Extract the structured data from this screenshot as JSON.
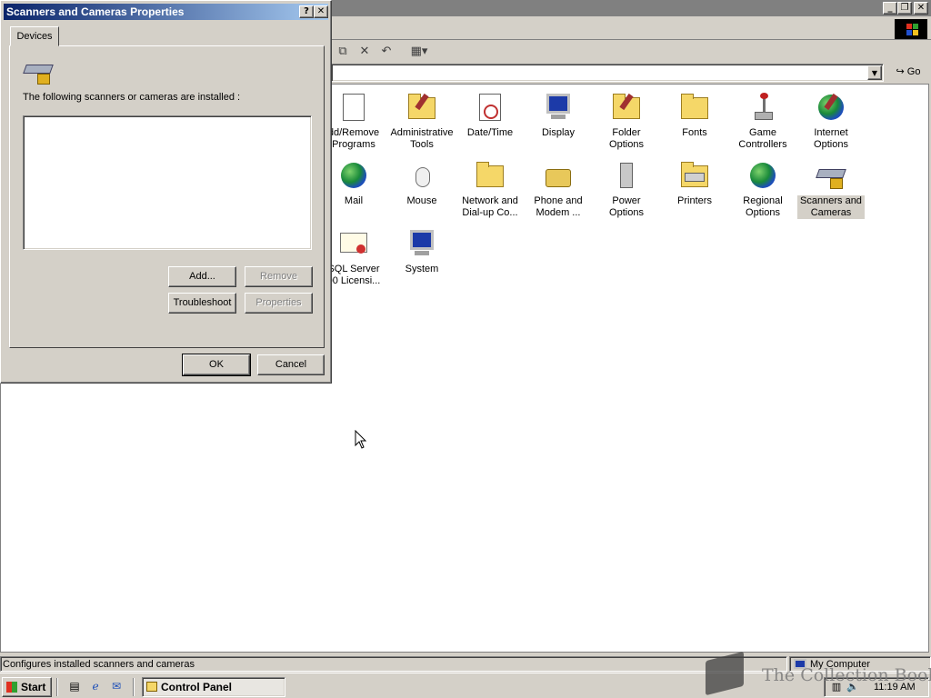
{
  "dialog": {
    "title": "Scanners and Cameras Properties",
    "help_glyph": "?",
    "close_glyph": "✕",
    "tab_devices": "Devices",
    "message": "The following scanners or cameras are installed :",
    "buttons": {
      "add": "Add...",
      "remove": "Remove",
      "troubleshoot": "Troubleshoot",
      "properties": "Properties",
      "ok": "OK",
      "cancel": "Cancel"
    }
  },
  "control_panel": {
    "items": [
      {
        "label": "dd/Remove Programs",
        "icon": "add-remove-programs-icon"
      },
      {
        "label": "Administrative Tools",
        "icon": "administrative-tools-icon"
      },
      {
        "label": "Date/Time",
        "icon": "date-time-icon"
      },
      {
        "label": "Display",
        "icon": "display-icon"
      },
      {
        "label": "Folder Options",
        "icon": "folder-options-icon"
      },
      {
        "label": "Fonts",
        "icon": "fonts-icon"
      },
      {
        "label": "Game Controllers",
        "icon": "game-controllers-icon"
      },
      {
        "label": "Internet Options",
        "icon": "internet-options-icon"
      },
      {
        "label": "Mail",
        "icon": "mail-icon"
      },
      {
        "label": "Mouse",
        "icon": "mouse-icon"
      },
      {
        "label": "Network and Dial-up Co...",
        "icon": "network-icon"
      },
      {
        "label": "Phone and Modem ...",
        "icon": "phone-modem-icon"
      },
      {
        "label": "Power Options",
        "icon": "power-options-icon"
      },
      {
        "label": "Printers",
        "icon": "printers-icon"
      },
      {
        "label": "Regional Options",
        "icon": "regional-options-icon"
      },
      {
        "label": "Scanners and Cameras",
        "icon": "scanners-cameras-icon"
      },
      {
        "label": "SQL Server 00 Licensi...",
        "icon": "sql-licensing-icon"
      },
      {
        "label": "System",
        "icon": "system-icon"
      }
    ],
    "go_label": "Go",
    "status_text": "Configures installed scanners and cameras",
    "status_zone": "My Computer"
  },
  "taskbar": {
    "start_label": "Start",
    "task_label": "Control Panel",
    "clock": "11:19 AM"
  },
  "watermark": "The Collection Book"
}
